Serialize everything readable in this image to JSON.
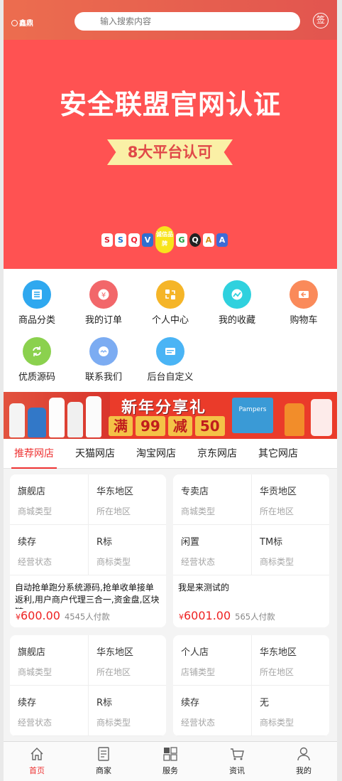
{
  "header": {
    "logo_text": "鑫鼎",
    "search_placeholder": "输入搜索内容",
    "sign_label": "签"
  },
  "banner": {
    "title": "安全联盟官网认证",
    "ribbon": "8大平台认可",
    "badges": [
      "S",
      "S",
      "Q",
      "V",
      "诚信品牌",
      "G",
      "Q",
      "A",
      "A"
    ],
    "background": "#ff5252"
  },
  "icon_grid": [
    {
      "label": "商品分类",
      "color": "#2fa8ef",
      "icon": "list-icon"
    },
    {
      "label": "我的订单",
      "color": "#f2676a",
      "icon": "yen-icon"
    },
    {
      "label": "个人中心",
      "color": "#f5b528",
      "icon": "swap-icon"
    },
    {
      "label": "我的收藏",
      "color": "#2fd1de",
      "icon": "trend-icon"
    },
    {
      "label": "购物车",
      "color": "#fa8a5a",
      "icon": "cart-icon"
    },
    {
      "label": "优质源码",
      "color": "#8bd14e",
      "icon": "refresh-icon"
    },
    {
      "label": "联系我们",
      "color": "#7cacf2",
      "icon": "chat-icon"
    },
    {
      "label": "后台自定义",
      "color": "#4ab4f5",
      "icon": "ad-icon"
    }
  ],
  "promo": {
    "title": "新年分享礼",
    "sub": [
      "满",
      "99",
      "减",
      "50"
    ],
    "box_label": "Pampers"
  },
  "tabs": [
    "推荐网店",
    "天猫网店",
    "淘宝网店",
    "京东网店",
    "其它网店"
  ],
  "active_tab": 0,
  "stores": [
    {
      "rows": [
        [
          {
            "value": "旗舰店",
            "key": "商城类型"
          },
          {
            "value": "华东地区",
            "key": "所在地区"
          }
        ],
        [
          {
            "value": "续存",
            "key": "经营状态"
          },
          {
            "value": "R标",
            "key": "商标类型"
          }
        ]
      ],
      "desc": "自动抢单跑分系统源码,抢单收单接单返利,用户商户代理三合一,资金盘,区块链",
      "price": "600.00",
      "count": "4545人付款"
    },
    {
      "rows": [
        [
          {
            "value": "专卖店",
            "key": "商城类型"
          },
          {
            "value": "华贡地区",
            "key": "所在地区"
          }
        ],
        [
          {
            "value": "闲置",
            "key": "经营状态"
          },
          {
            "value": "TM标",
            "key": "商标类型"
          }
        ]
      ],
      "desc": "我是来测试的",
      "price": "6001.00",
      "count": "565人付款"
    },
    {
      "rows": [
        [
          {
            "value": "旗舰店",
            "key": "商城类型"
          },
          {
            "value": "华东地区",
            "key": "所在地区"
          }
        ],
        [
          {
            "value": "续存",
            "key": "经营状态"
          },
          {
            "value": "R标",
            "key": "商标类型"
          }
        ]
      ],
      "desc": "",
      "price": "",
      "count": ""
    },
    {
      "rows": [
        [
          {
            "value": "个人店",
            "key": "店铺类型"
          },
          {
            "value": "华东地区",
            "key": "所在地区"
          }
        ],
        [
          {
            "value": "续存",
            "key": "经营状态"
          },
          {
            "value": "无",
            "key": "商标类型"
          }
        ]
      ],
      "desc": "",
      "price": "",
      "count": ""
    }
  ],
  "currency": "¥",
  "bottom_nav": [
    {
      "label": "首页",
      "icon": "home-icon"
    },
    {
      "label": "商家",
      "icon": "document-icon"
    },
    {
      "label": "服务",
      "icon": "grid-icon"
    },
    {
      "label": "资讯",
      "icon": "cart-icon"
    },
    {
      "label": "我的",
      "icon": "user-icon"
    }
  ],
  "active_nav": 0,
  "accent_color": "#ee3333"
}
